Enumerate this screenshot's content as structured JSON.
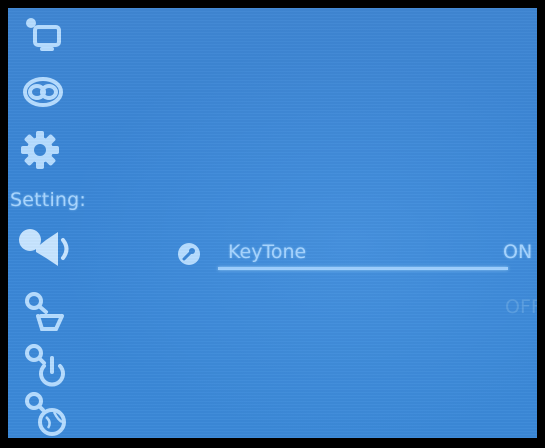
{
  "colors": {
    "screen_background": "#3b87d6",
    "glyph": "#a9d6ff",
    "dim_text": "#5a9ee0"
  },
  "sidebar": {
    "items": [
      {
        "icon": "display-icon"
      },
      {
        "icon": "link-icon"
      },
      {
        "icon": "gear-icon"
      },
      {
        "label": "Setting:"
      },
      {
        "icon": "speaker-icon",
        "selected": true
      },
      {
        "icon": "wrench-tv-icon"
      },
      {
        "icon": "wrench-power-icon"
      },
      {
        "icon": "wrench-globe-icon"
      }
    ]
  },
  "options": {
    "keytone": {
      "label": "KeyTone",
      "icon": "wrench-icon",
      "choices": [
        "ON",
        "OFF"
      ],
      "selected": "ON"
    }
  }
}
